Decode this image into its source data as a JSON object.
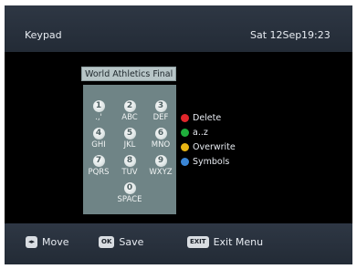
{
  "header": {
    "title": "Keypad",
    "date": "Sat 12Sep",
    "time": "19:23"
  },
  "input": {
    "value": "World Athletics Final"
  },
  "keypad": {
    "keys": [
      {
        "number": "1",
        "label": ".,'"
      },
      {
        "number": "2",
        "label": "ABC"
      },
      {
        "number": "3",
        "label": "DEF"
      },
      {
        "number": "4",
        "label": "GHI"
      },
      {
        "number": "5",
        "label": "JKL"
      },
      {
        "number": "6",
        "label": "MNO"
      },
      {
        "number": "7",
        "label": "PQRS"
      },
      {
        "number": "8",
        "label": "TUV"
      },
      {
        "number": "9",
        "label": "WXYZ"
      },
      {
        "number": "0",
        "label": "SPACE"
      }
    ]
  },
  "legend": {
    "items": [
      {
        "label": "Delete",
        "color": "#e0262b"
      },
      {
        "label": "a..z",
        "color": "#1fae3c"
      },
      {
        "label": "Overwrite",
        "color": "#e8b514"
      },
      {
        "label": "Symbols",
        "color": "#3a86d6"
      }
    ]
  },
  "footer": {
    "move": {
      "key_icon": "left-right-arrows-icon",
      "label": "Move"
    },
    "save": {
      "key": "OK",
      "label": "Save"
    },
    "exit": {
      "key": "EXIT",
      "label": "Exit Menu"
    }
  },
  "colors": {
    "panel": "#2a333f",
    "keypad_bg": "#6f8486",
    "input_bg": "#b7c5c7"
  }
}
